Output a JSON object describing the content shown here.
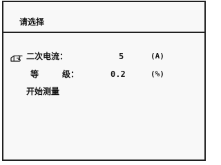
{
  "dialog": {
    "title": "请选择"
  },
  "menu": {
    "current": {
      "label": "二次电流：",
      "value": "5",
      "unit": "(A)",
      "cursor_icon": "pointing-hand-icon"
    },
    "grade": {
      "label_char_1": "等",
      "label_char_2": "级：",
      "value": "0.2",
      "unit": "(%)"
    },
    "start": {
      "label": "开始测量"
    }
  }
}
